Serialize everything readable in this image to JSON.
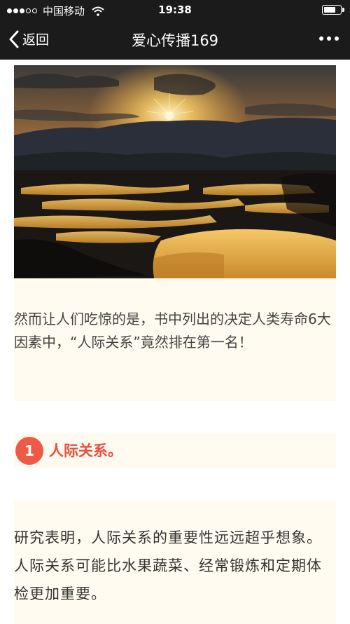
{
  "status_bar": {
    "carrier": "中国移动",
    "time": "19:38",
    "signal_bars_filled": 3,
    "signal_bars_total": 5
  },
  "nav": {
    "back_label": "返回",
    "title": "爱心传播169"
  },
  "article": {
    "paragraph_1": "然而让人们吃惊的是，书中列出的决定人类寿命6大因素中，“人际关系”竟然排在第一名！",
    "section_number": "1",
    "section_title": "人际关系。",
    "paragraph_2": "研究表明，人际关系的重要性远远超乎想象。人际关系可能比水果蔬菜、经常锻炼和定期体检更加重要。"
  },
  "colors": {
    "bar_background": "#1b1b1b",
    "card_background": "#fffbf0",
    "accent_red": "#ef5a47"
  }
}
